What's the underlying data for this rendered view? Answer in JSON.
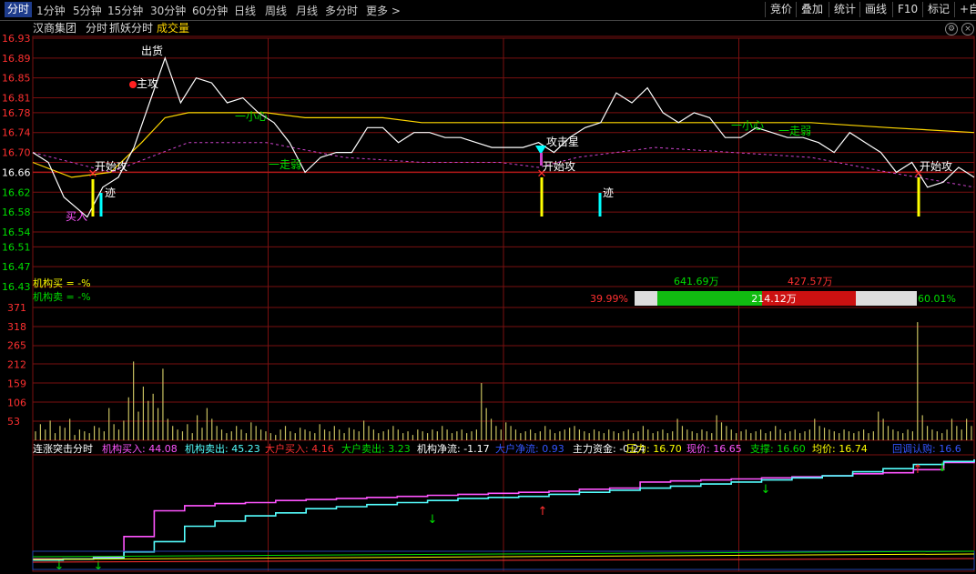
{
  "toolbar": {
    "tabs": [
      "分时",
      "1分钟",
      "5分钟",
      "15分钟",
      "30分钟",
      "60分钟",
      "日线",
      "周线",
      "月线",
      "多分时",
      "更多 >"
    ],
    "active_tab": "分时",
    "right_buttons": [
      "竞价",
      "叠加",
      "统计",
      "画线",
      "F10",
      "标记",
      "+自"
    ]
  },
  "header": {
    "stock_name": "汉商集团",
    "chart_mode": "分时",
    "indicator_name": "抓妖分时",
    "volume_label": "成交量"
  },
  "colors": {
    "price_line": "#ffffff",
    "avg_line": "#ffd700",
    "ma_dash": "#cc44cc",
    "grid": "#7a1010",
    "up": "#ff3030",
    "down": "#00dd00",
    "volume": "#c8c060"
  },
  "chart_data": [
    {
      "type": "line",
      "panel": "price",
      "y_ticks": [
        16.93,
        16.89,
        16.85,
        16.81,
        16.78,
        16.74,
        16.7,
        16.66,
        16.62,
        16.58,
        16.54,
        16.51,
        16.47,
        16.43
      ],
      "ylim": [
        16.43,
        16.93
      ],
      "prev_close": 16.66,
      "series": [
        {
          "name": "price",
          "x": [
            0,
            4,
            8,
            14,
            18,
            22,
            26,
            30,
            34,
            38,
            42,
            46,
            50,
            54,
            58,
            62,
            66,
            70,
            74,
            78,
            82,
            86,
            90,
            94,
            98,
            102,
            106,
            110,
            114,
            118,
            122,
            126,
            130,
            134,
            138,
            142,
            146,
            150,
            154,
            158,
            162,
            166,
            170,
            174,
            178,
            182,
            186,
            190,
            194,
            198,
            202,
            206,
            210,
            214,
            218,
            222,
            226,
            230,
            234,
            238,
            242
          ],
          "values": [
            16.7,
            16.68,
            16.61,
            16.57,
            16.63,
            16.65,
            16.71,
            16.8,
            16.89,
            16.8,
            16.85,
            16.84,
            16.8,
            16.81,
            16.78,
            16.76,
            16.72,
            16.66,
            16.69,
            16.7,
            16.7,
            16.75,
            16.75,
            16.72,
            16.74,
            16.74,
            16.73,
            16.73,
            16.72,
            16.71,
            16.71,
            16.71,
            16.72,
            16.7,
            16.73,
            16.75,
            16.76,
            16.82,
            16.8,
            16.83,
            16.78,
            16.76,
            16.78,
            16.77,
            16.73,
            16.73,
            16.75,
            16.74,
            16.73,
            16.73,
            16.72,
            16.7,
            16.74,
            16.72,
            16.7,
            16.66,
            16.68,
            16.63,
            16.64,
            16.67,
            16.65
          ]
        },
        {
          "name": "avg",
          "x": [
            0,
            10,
            20,
            28,
            34,
            40,
            50,
            60,
            70,
            80,
            90,
            100,
            120,
            140,
            160,
            180,
            200,
            220,
            242
          ],
          "values": [
            16.68,
            16.65,
            16.66,
            16.72,
            16.77,
            16.78,
            16.78,
            16.78,
            16.77,
            16.77,
            16.77,
            16.76,
            16.76,
            16.76,
            16.76,
            16.76,
            16.76,
            16.75,
            16.74
          ]
        },
        {
          "name": "ma",
          "x": [
            0,
            10,
            20,
            30,
            40,
            60,
            80,
            100,
            120,
            130,
            140,
            160,
            180,
            200,
            220,
            242
          ],
          "values": [
            16.7,
            16.68,
            16.66,
            16.69,
            16.72,
            16.72,
            16.69,
            16.68,
            16.68,
            16.67,
            16.69,
            16.71,
            16.7,
            16.69,
            16.66,
            16.63
          ]
        }
      ],
      "annotations": [
        "出货",
        "主攻",
        "开始攻",
        "迹",
        "买入",
        "一小心",
        "一走弱",
        "攻击星",
        "开始攻",
        "迹",
        "一小心",
        "一走弱",
        "开始攻"
      ]
    },
    {
      "type": "bar",
      "panel": "volume",
      "y_ticks": [
        371,
        318,
        265,
        212,
        159,
        106,
        53
      ],
      "ylim": [
        0,
        371
      ],
      "values": [
        25,
        45,
        30,
        55,
        20,
        40,
        35,
        60,
        15,
        30,
        25,
        20,
        40,
        35,
        25,
        90,
        45,
        30,
        55,
        120,
        220,
        80,
        150,
        110,
        130,
        90,
        200,
        60,
        40,
        30,
        25,
        45,
        20,
        70,
        35,
        90,
        60,
        40,
        30,
        20,
        25,
        40,
        30,
        20,
        50,
        40,
        30,
        25,
        20,
        15,
        30,
        40,
        25,
        20,
        35,
        30,
        25,
        20,
        45,
        30,
        25,
        40,
        30,
        20,
        35,
        30,
        25,
        55,
        40,
        30,
        20,
        25,
        30,
        40,
        30,
        20,
        25,
        15,
        30,
        25,
        20,
        30,
        25,
        40,
        30,
        20,
        25,
        30,
        20,
        25,
        30,
        160,
        90,
        60,
        40,
        30,
        50,
        40,
        30,
        20,
        25,
        30,
        20,
        25,
        40,
        30,
        20,
        25,
        30,
        35,
        40,
        30,
        25,
        20,
        30,
        25,
        20,
        30,
        25,
        20,
        25,
        30,
        20,
        25,
        40,
        30,
        20,
        25,
        30,
        20,
        25,
        60,
        40,
        30,
        25,
        20,
        30,
        25,
        20,
        70,
        50,
        40,
        30,
        20,
        25,
        30,
        20,
        25,
        30,
        20,
        25,
        40,
        30,
        20,
        25,
        30,
        20,
        25,
        30,
        60,
        40,
        35,
        30,
        25,
        20,
        30,
        25,
        20,
        25,
        30,
        20,
        25,
        80,
        60,
        40,
        30,
        25,
        20,
        30,
        25,
        330,
        70,
        40,
        30,
        25,
        20,
        30,
        60,
        40,
        30,
        60,
        40
      ]
    },
    {
      "type": "line",
      "panel": "flow",
      "series": [
        {
          "name": "机构买入",
          "values": [
            0.03,
            0.03,
            0.05,
            0.25,
            0.5,
            0.55,
            0.57,
            0.58,
            0.6,
            0.61,
            0.62,
            0.63,
            0.64,
            0.65,
            0.66,
            0.67,
            0.68,
            0.69,
            0.71,
            0.72,
            0.78,
            0.79,
            0.8,
            0.81,
            0.82,
            0.83,
            0.84,
            0.86,
            0.87,
            0.9,
            0.97,
            1.0
          ]
        },
        {
          "name": "机构卖出",
          "values": [
            0.02,
            0.03,
            0.04,
            0.1,
            0.2,
            0.35,
            0.4,
            0.45,
            0.48,
            0.52,
            0.54,
            0.56,
            0.58,
            0.6,
            0.62,
            0.63,
            0.64,
            0.66,
            0.68,
            0.7,
            0.72,
            0.74,
            0.76,
            0.78,
            0.8,
            0.82,
            0.84,
            0.88,
            0.91,
            0.95,
            0.98,
            1.0
          ]
        }
      ]
    }
  ],
  "inst_panel": {
    "buy_label": "机构买 = -%",
    "sell_label": "机构卖 = -%",
    "buy_amount": "641.69万",
    "sell_amount": "427.57万",
    "net_amount": "214.12万",
    "left_pct": "39.99%",
    "right_pct": "60.01%"
  },
  "flow_legend": [
    {
      "text": "连涨突击分时",
      "color": "#ffffff"
    },
    {
      "text": "机构买入: 44.08",
      "color": "#ff55ff"
    },
    {
      "text": "机构卖出: 45.23",
      "color": "#55ffff"
    },
    {
      "text": "大户买入: 4.16",
      "color": "#ff3030"
    },
    {
      "text": "大户卖出: 3.23",
      "color": "#00dd00"
    },
    {
      "text": "机构净流: -1.17",
      "color": "#ffffff"
    },
    {
      "text": "大户净流: 0.93",
      "color": "#3355ff"
    },
    {
      "text": "主力资金: -0.24",
      "color": "#ffffff"
    },
    {
      "text": "压力: 16.70",
      "color": "#ffff00"
    },
    {
      "text": "现价: 16.65",
      "color": "#ff55ff"
    },
    {
      "text": "支撑: 16.60",
      "color": "#00dd00"
    },
    {
      "text": "均价: 16.74",
      "color": "#ffff00"
    },
    {
      "text": "回调认购: 16.6",
      "color": "#3355ff"
    }
  ]
}
